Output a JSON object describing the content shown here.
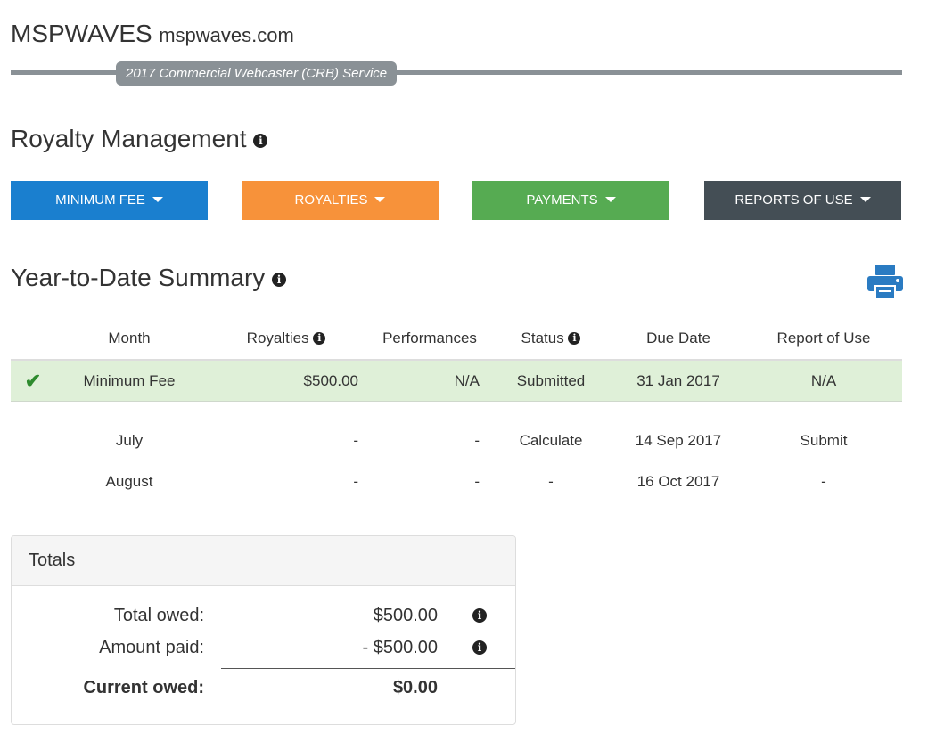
{
  "header": {
    "brand": "MSPWAVES",
    "domain": "mspwaves.com",
    "service": "2017 Commercial Webcaster (CRB) Service"
  },
  "page": {
    "title": "Royalty Management"
  },
  "menu": [
    {
      "label": "MINIMUM FEE",
      "color": "#1a7fcf"
    },
    {
      "label": "ROYALTIES",
      "color": "#f7923a"
    },
    {
      "label": "PAYMENTS",
      "color": "#56ab52"
    },
    {
      "label": "REPORTS OF USE",
      "color": "#444e55"
    }
  ],
  "summary": {
    "title": "Year-to-Date Summary",
    "columns": [
      "Month",
      "Royalties",
      "Performances",
      "Status",
      "Due Date",
      "Report of Use"
    ],
    "rows": [
      {
        "month": "Minimum Fee",
        "royalties": "$500.00",
        "performances": "N/A",
        "status": "Submitted",
        "due_date": "31 Jan 2017",
        "report": "N/A",
        "checked": true
      },
      {
        "month": "July",
        "royalties": "-",
        "performances": "-",
        "status": "Calculate",
        "due_date": "14 Sep 2017",
        "report": "Submit"
      },
      {
        "month": "August",
        "royalties": "-",
        "performances": "-",
        "status": "-",
        "due_date": "16 Oct 2017",
        "report": "-"
      }
    ]
  },
  "totals": {
    "title": "Totals",
    "total_owed_label": "Total owed:",
    "total_owed_value": "$500.00",
    "amount_paid_label": "Amount paid:",
    "amount_paid_value": "- $500.00",
    "current_owed_label": "Current owed:",
    "current_owed_value": "$0.00"
  },
  "colors": {
    "accent_blue": "#1a7fcf",
    "accent_orange": "#f7923a",
    "accent_green": "#56ab52",
    "accent_dark": "#444e55",
    "highlight_row": "#dff0d8",
    "print_icon": "#2a7bc2"
  },
  "icons": {
    "info": "info-circle-icon",
    "caret": "caret-down-icon",
    "print": "printer-icon",
    "check": "checkmark-icon"
  }
}
